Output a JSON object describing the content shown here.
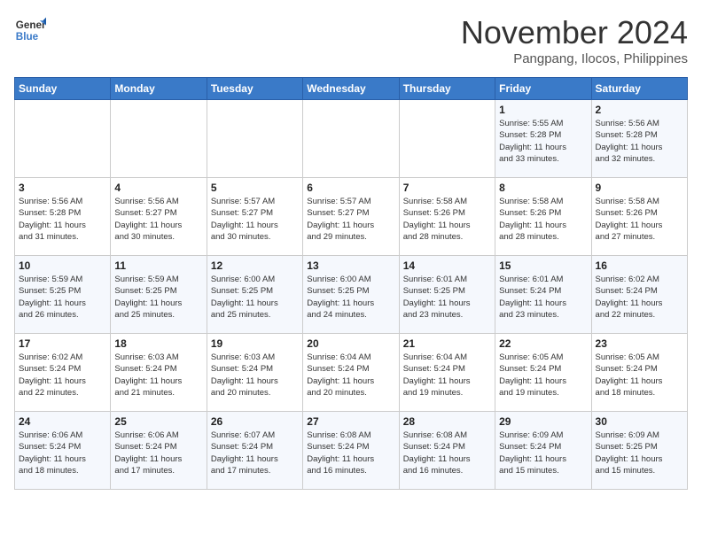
{
  "header": {
    "logo_line1": "General",
    "logo_line2": "Blue",
    "month": "November 2024",
    "location": "Pangpang, Ilocos, Philippines"
  },
  "weekdays": [
    "Sunday",
    "Monday",
    "Tuesday",
    "Wednesday",
    "Thursday",
    "Friday",
    "Saturday"
  ],
  "weeks": [
    [
      {
        "day": "",
        "info": ""
      },
      {
        "day": "",
        "info": ""
      },
      {
        "day": "",
        "info": ""
      },
      {
        "day": "",
        "info": ""
      },
      {
        "day": "",
        "info": ""
      },
      {
        "day": "1",
        "info": "Sunrise: 5:55 AM\nSunset: 5:28 PM\nDaylight: 11 hours\nand 33 minutes."
      },
      {
        "day": "2",
        "info": "Sunrise: 5:56 AM\nSunset: 5:28 PM\nDaylight: 11 hours\nand 32 minutes."
      }
    ],
    [
      {
        "day": "3",
        "info": "Sunrise: 5:56 AM\nSunset: 5:28 PM\nDaylight: 11 hours\nand 31 minutes."
      },
      {
        "day": "4",
        "info": "Sunrise: 5:56 AM\nSunset: 5:27 PM\nDaylight: 11 hours\nand 30 minutes."
      },
      {
        "day": "5",
        "info": "Sunrise: 5:57 AM\nSunset: 5:27 PM\nDaylight: 11 hours\nand 30 minutes."
      },
      {
        "day": "6",
        "info": "Sunrise: 5:57 AM\nSunset: 5:27 PM\nDaylight: 11 hours\nand 29 minutes."
      },
      {
        "day": "7",
        "info": "Sunrise: 5:58 AM\nSunset: 5:26 PM\nDaylight: 11 hours\nand 28 minutes."
      },
      {
        "day": "8",
        "info": "Sunrise: 5:58 AM\nSunset: 5:26 PM\nDaylight: 11 hours\nand 28 minutes."
      },
      {
        "day": "9",
        "info": "Sunrise: 5:58 AM\nSunset: 5:26 PM\nDaylight: 11 hours\nand 27 minutes."
      }
    ],
    [
      {
        "day": "10",
        "info": "Sunrise: 5:59 AM\nSunset: 5:25 PM\nDaylight: 11 hours\nand 26 minutes."
      },
      {
        "day": "11",
        "info": "Sunrise: 5:59 AM\nSunset: 5:25 PM\nDaylight: 11 hours\nand 25 minutes."
      },
      {
        "day": "12",
        "info": "Sunrise: 6:00 AM\nSunset: 5:25 PM\nDaylight: 11 hours\nand 25 minutes."
      },
      {
        "day": "13",
        "info": "Sunrise: 6:00 AM\nSunset: 5:25 PM\nDaylight: 11 hours\nand 24 minutes."
      },
      {
        "day": "14",
        "info": "Sunrise: 6:01 AM\nSunset: 5:25 PM\nDaylight: 11 hours\nand 23 minutes."
      },
      {
        "day": "15",
        "info": "Sunrise: 6:01 AM\nSunset: 5:24 PM\nDaylight: 11 hours\nand 23 minutes."
      },
      {
        "day": "16",
        "info": "Sunrise: 6:02 AM\nSunset: 5:24 PM\nDaylight: 11 hours\nand 22 minutes."
      }
    ],
    [
      {
        "day": "17",
        "info": "Sunrise: 6:02 AM\nSunset: 5:24 PM\nDaylight: 11 hours\nand 22 minutes."
      },
      {
        "day": "18",
        "info": "Sunrise: 6:03 AM\nSunset: 5:24 PM\nDaylight: 11 hours\nand 21 minutes."
      },
      {
        "day": "19",
        "info": "Sunrise: 6:03 AM\nSunset: 5:24 PM\nDaylight: 11 hours\nand 20 minutes."
      },
      {
        "day": "20",
        "info": "Sunrise: 6:04 AM\nSunset: 5:24 PM\nDaylight: 11 hours\nand 20 minutes."
      },
      {
        "day": "21",
        "info": "Sunrise: 6:04 AM\nSunset: 5:24 PM\nDaylight: 11 hours\nand 19 minutes."
      },
      {
        "day": "22",
        "info": "Sunrise: 6:05 AM\nSunset: 5:24 PM\nDaylight: 11 hours\nand 19 minutes."
      },
      {
        "day": "23",
        "info": "Sunrise: 6:05 AM\nSunset: 5:24 PM\nDaylight: 11 hours\nand 18 minutes."
      }
    ],
    [
      {
        "day": "24",
        "info": "Sunrise: 6:06 AM\nSunset: 5:24 PM\nDaylight: 11 hours\nand 18 minutes."
      },
      {
        "day": "25",
        "info": "Sunrise: 6:06 AM\nSunset: 5:24 PM\nDaylight: 11 hours\nand 17 minutes."
      },
      {
        "day": "26",
        "info": "Sunrise: 6:07 AM\nSunset: 5:24 PM\nDaylight: 11 hours\nand 17 minutes."
      },
      {
        "day": "27",
        "info": "Sunrise: 6:08 AM\nSunset: 5:24 PM\nDaylight: 11 hours\nand 16 minutes."
      },
      {
        "day": "28",
        "info": "Sunrise: 6:08 AM\nSunset: 5:24 PM\nDaylight: 11 hours\nand 16 minutes."
      },
      {
        "day": "29",
        "info": "Sunrise: 6:09 AM\nSunset: 5:24 PM\nDaylight: 11 hours\nand 15 minutes."
      },
      {
        "day": "30",
        "info": "Sunrise: 6:09 AM\nSunset: 5:25 PM\nDaylight: 11 hours\nand 15 minutes."
      }
    ]
  ]
}
